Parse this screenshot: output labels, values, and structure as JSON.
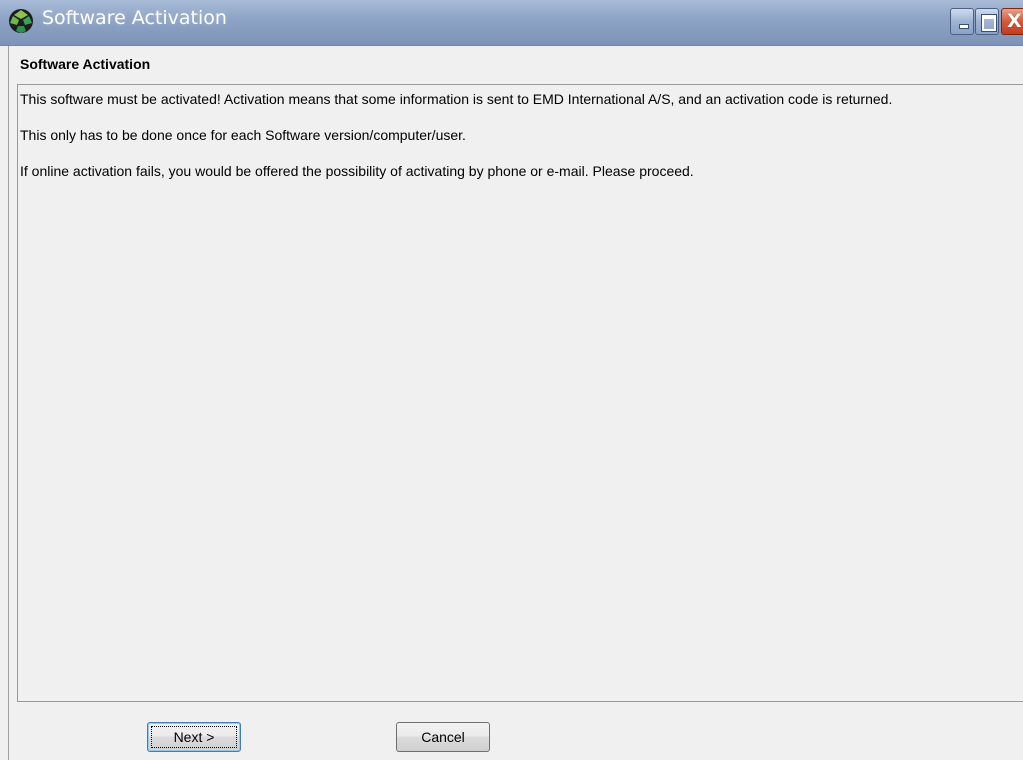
{
  "window": {
    "title": "Software Activation",
    "icon": "app-logo-icon",
    "controls": {
      "minimize": "minimize-icon",
      "maximize": "maximize-icon",
      "close": "close-icon",
      "close_glyph": "X"
    }
  },
  "header": {
    "title": "Software Activation"
  },
  "content": {
    "paragraphs": [
      "This software must be activated! Activation means that some information is sent to EMD International A/S, and an activation code is returned.",
      "This only has to be done once for each Software version/computer/user.",
      "If online activation fails, you would be offered the possibility of activating by phone or e-mail. Please proceed."
    ]
  },
  "buttons": {
    "next_label": "Next >",
    "cancel_label": "Cancel"
  },
  "colors": {
    "titlebar": "#8ea4c6",
    "close_button": "#d4593b",
    "background": "#f0f0f0"
  }
}
